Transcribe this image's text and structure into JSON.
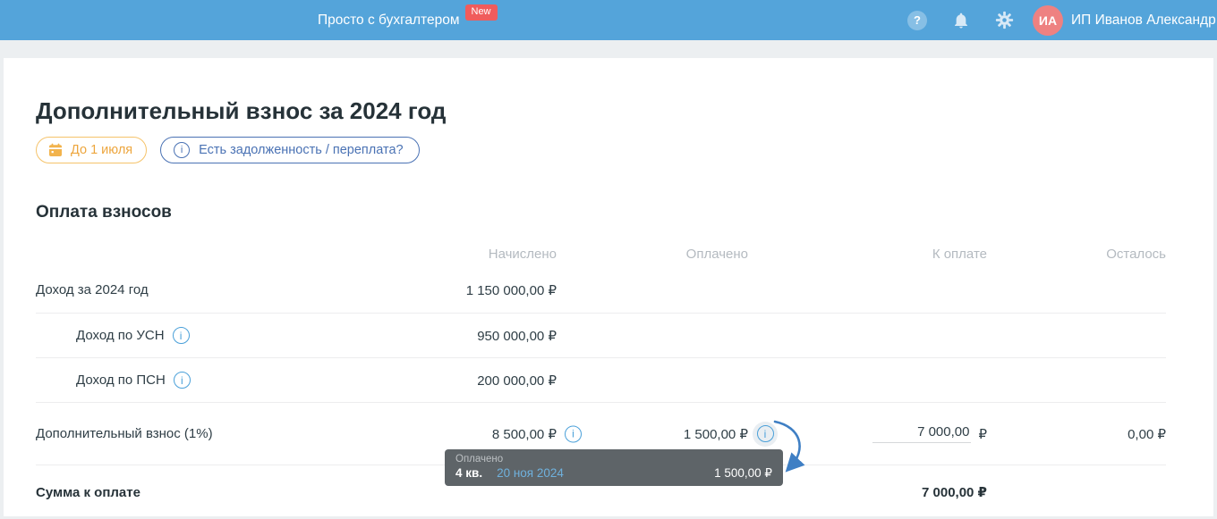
{
  "topbar": {
    "brand": "Просто с бухгалтером",
    "new_badge": "New",
    "help_glyph": "?",
    "avatar_initials": "ИА",
    "user_name": "ИП Иванов Александр"
  },
  "page": {
    "title": "Дополнительный взнос за 2024 год",
    "deadline_badge": "До 1 июля",
    "debt_badge": "Есть задолженность / переплата?",
    "debt_badge_icon": "i",
    "info_glyph": "i",
    "section_title": "Оплата взносов"
  },
  "table": {
    "columns": [
      "Начислено",
      "Оплачено",
      "К оплате",
      "Осталось"
    ],
    "rows": [
      {
        "label": "Доход за 2024 год",
        "accrued": "1 150 000,00 ₽"
      },
      {
        "label": "Доход по УСН",
        "accrued": "950 000,00 ₽"
      },
      {
        "label": "Доход по ПСН",
        "accrued": "200 000,00 ₽"
      },
      {
        "label": "Дополнительный взнос (1%)",
        "accrued": "8 500,00 ₽",
        "paid": "1 500,00 ₽",
        "to_pay_value": "7 000,00",
        "to_pay_currency": "₽",
        "remaining": "0,00 ₽"
      },
      {
        "label": "Сумма к оплате",
        "to_pay": "7 000,00 ₽"
      }
    ]
  },
  "tooltip": {
    "label": "Оплачено",
    "quarter": "4 кв.",
    "date": "20 ноя 2024",
    "amount": "1 500,00 ₽"
  },
  "colors": {
    "topbar": "#54a4da",
    "new_badge": "#f05c5c",
    "avatar": "#ee8181",
    "deadline_accent": "#eda63e",
    "debt_accent": "#4a72b4",
    "info_icon": "#4aa0d9",
    "tooltip_bg": "#5e6468",
    "tooltip_link": "#6fb1dd",
    "arrow": "#3f7fc4",
    "page_bg": "#eceff1"
  }
}
